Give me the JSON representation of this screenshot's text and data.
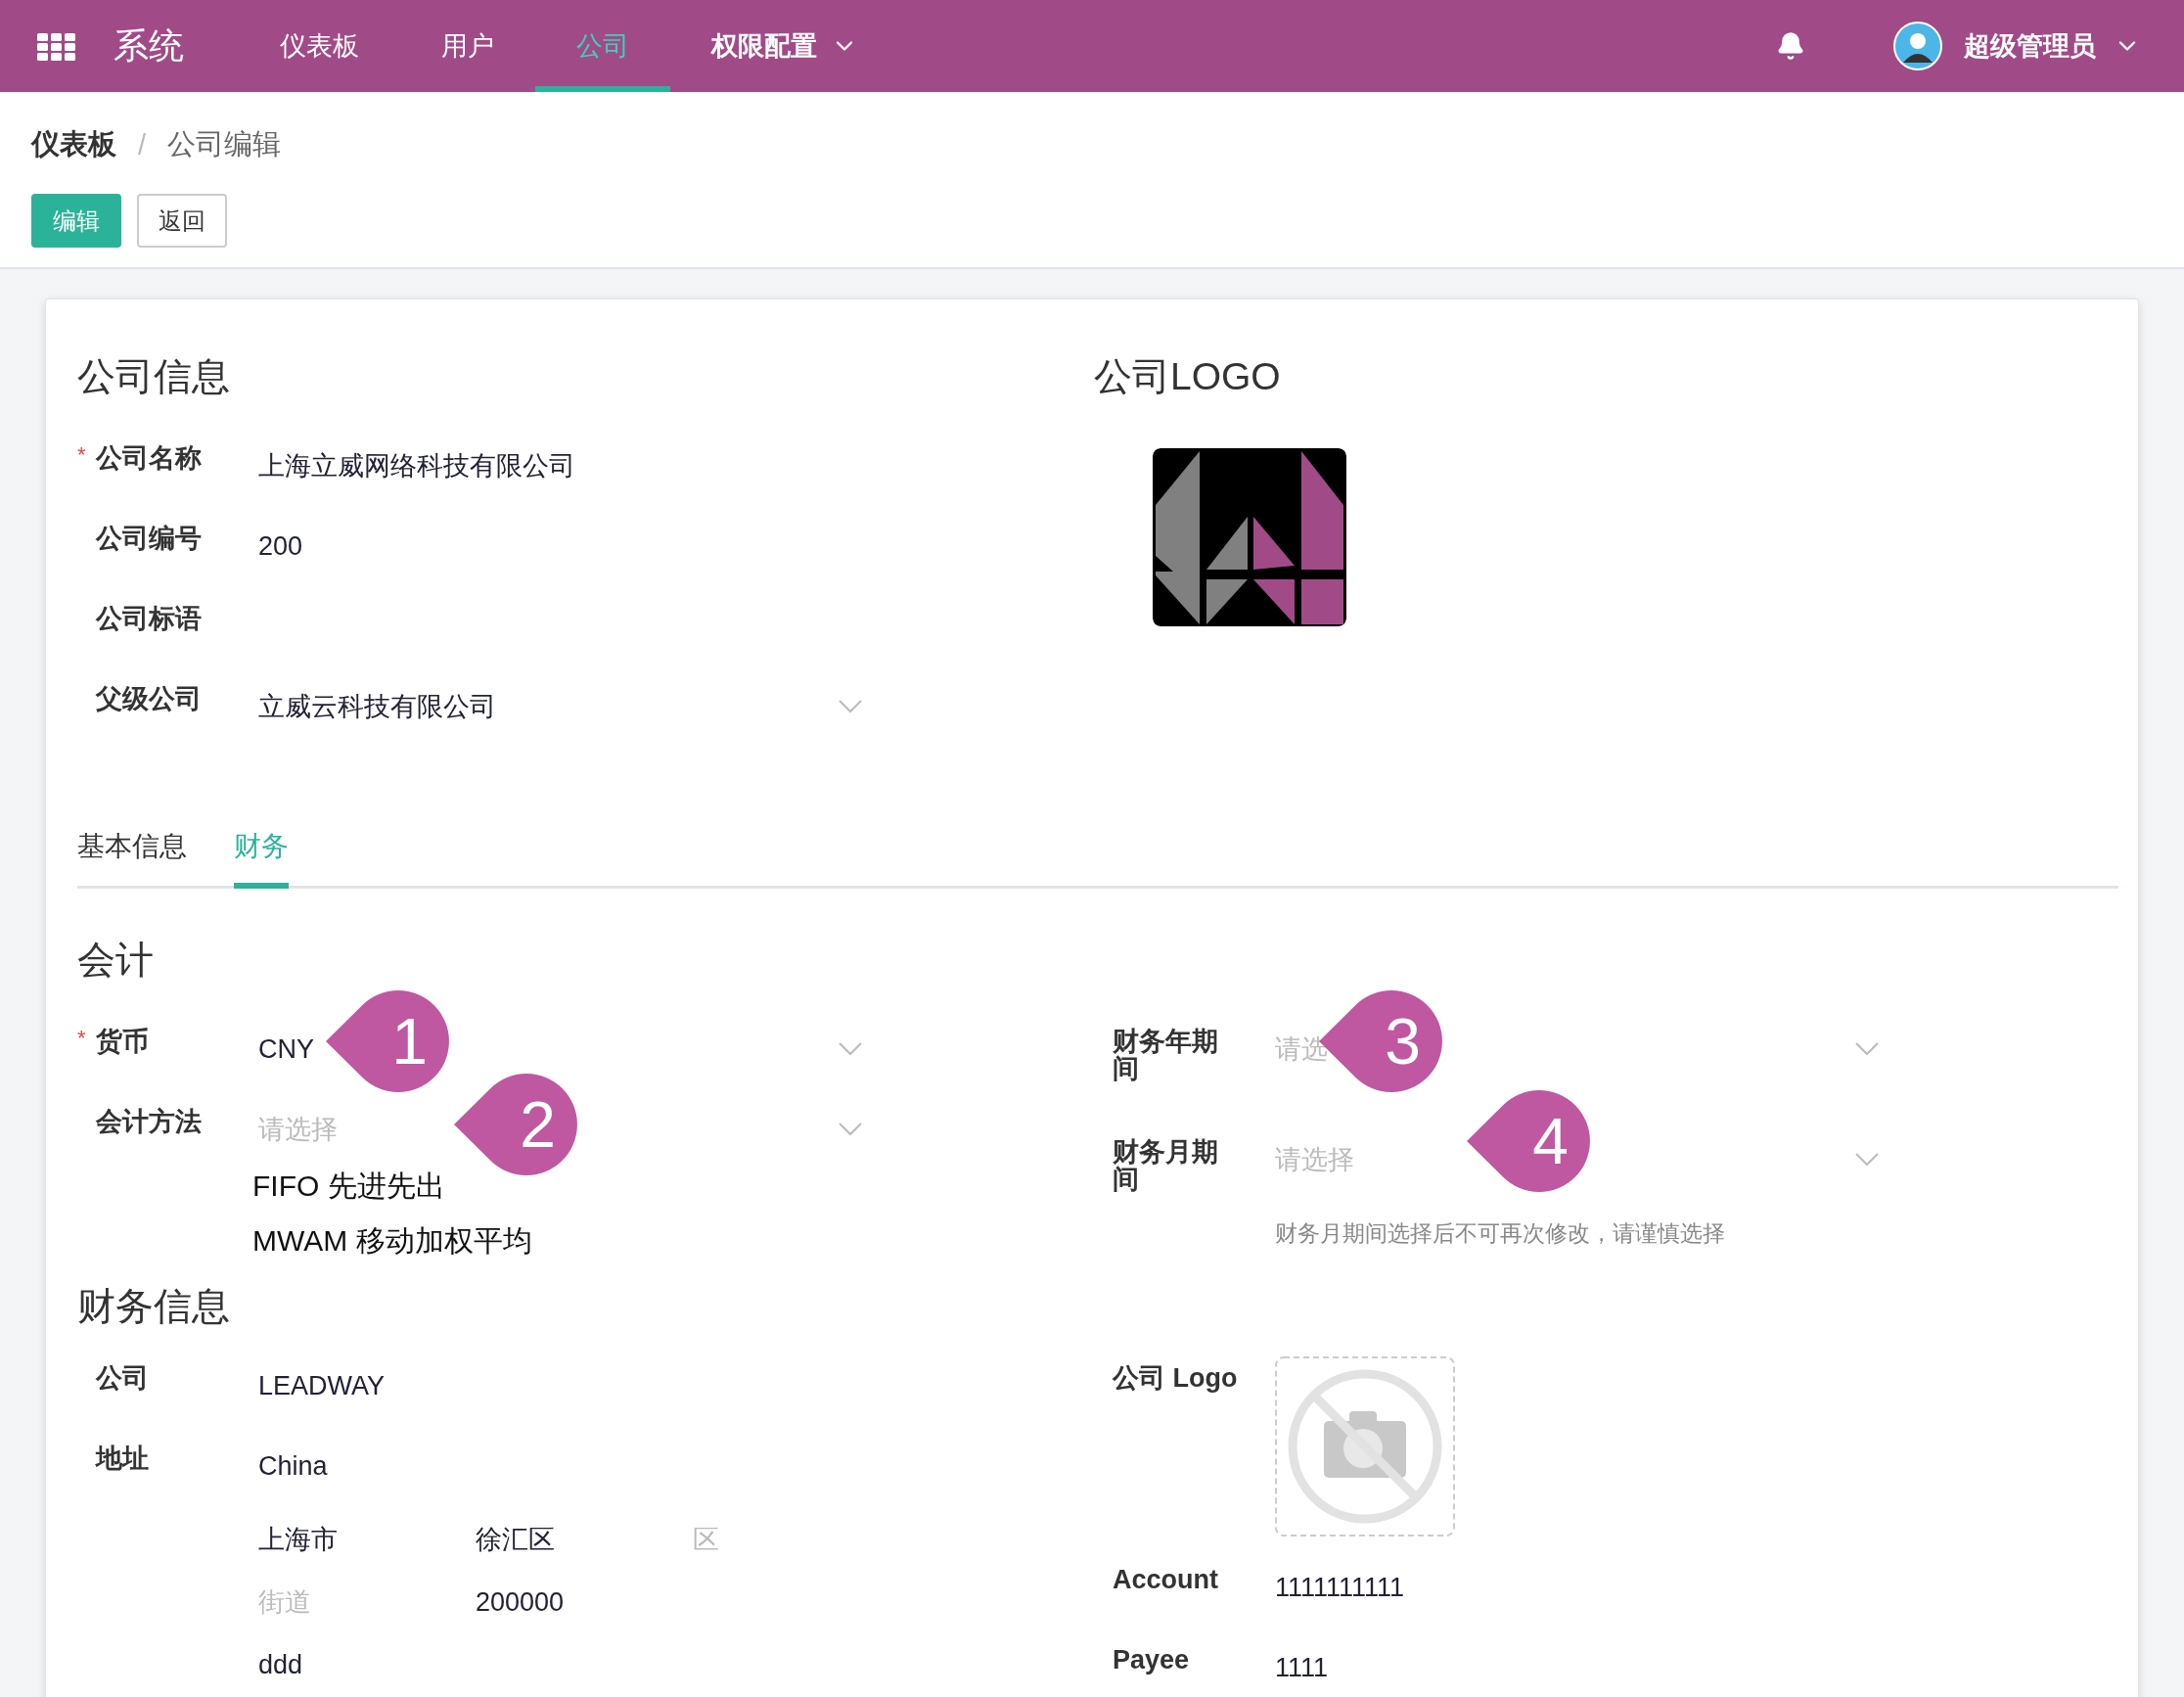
{
  "nav": {
    "brand": "系统",
    "items": [
      {
        "label": "仪表板",
        "selected": false,
        "dropdown": false
      },
      {
        "label": "用户",
        "selected": false,
        "dropdown": false
      },
      {
        "label": "公司",
        "selected": true,
        "dropdown": false
      },
      {
        "label": "权限配置",
        "selected": false,
        "dropdown": true
      }
    ],
    "user": "超级管理员"
  },
  "breadcrumb": {
    "items": [
      "仪表板",
      "公司编辑"
    ],
    "separator": "/"
  },
  "actions": [
    {
      "label": "编辑",
      "kind": "primary"
    },
    {
      "label": "返回",
      "kind": "secondary"
    }
  ],
  "required_mark": "*",
  "company": {
    "title": "公司信息",
    "fields": [
      {
        "label": "公司名称",
        "required": true,
        "kind": "text",
        "value": "上海立威网络科技有限公司"
      },
      {
        "label": "公司编号",
        "required": false,
        "kind": "text",
        "value": "200"
      },
      {
        "label": "公司标语",
        "required": false,
        "kind": "text"
      },
      {
        "label": "父级公司",
        "required": false,
        "kind": "select",
        "value": "立威云科技有限公司"
      }
    ],
    "logo_title": "公司LOGO"
  },
  "tabs": [
    {
      "label": "基本信息",
      "selected": false
    },
    {
      "label": "财务",
      "selected": true
    }
  ],
  "accounting": {
    "title": "会计",
    "left": [
      {
        "label": "货币",
        "required": true,
        "kind": "select",
        "value": "CNY"
      },
      {
        "label": "会计方法",
        "required": false,
        "kind": "select",
        "placeholder": "请选择",
        "options": [
          "FIFO 先进先出",
          "MWAM 移动加权平均"
        ]
      }
    ],
    "right": [
      {
        "label": "财务年期间",
        "required": false,
        "kind": "select",
        "placeholder": "请选"
      },
      {
        "label": "财务月期间",
        "required": false,
        "kind": "select",
        "placeholder": "请选择",
        "hint": "财务月期间选择后不可再次修改，请谨慎选择"
      }
    ]
  },
  "finance": {
    "title": "财务信息",
    "left": [
      {
        "label": "公司",
        "kind": "text",
        "value": "LEADWAY"
      },
      {
        "label": "地址",
        "kind": "address",
        "value": "China",
        "lines": [
          [
            {
              "value": "上海市"
            },
            {
              "value": "徐汇区"
            },
            {
              "placeholder": "区"
            }
          ],
          [
            {
              "placeholder": "街道"
            },
            {
              "value": "200000"
            }
          ],
          [
            {
              "value": "ddd"
            }
          ]
        ]
      }
    ],
    "right": [
      {
        "label": "公司 Logo",
        "kind": "image"
      },
      {
        "label": "Account",
        "kind": "text",
        "value": "1111111111"
      },
      {
        "label": "Payee",
        "kind": "text",
        "value": "1111"
      }
    ]
  },
  "callouts": [
    {
      "label": "1"
    },
    {
      "label": "2"
    },
    {
      "label": "3"
    },
    {
      "label": "4"
    }
  ]
}
